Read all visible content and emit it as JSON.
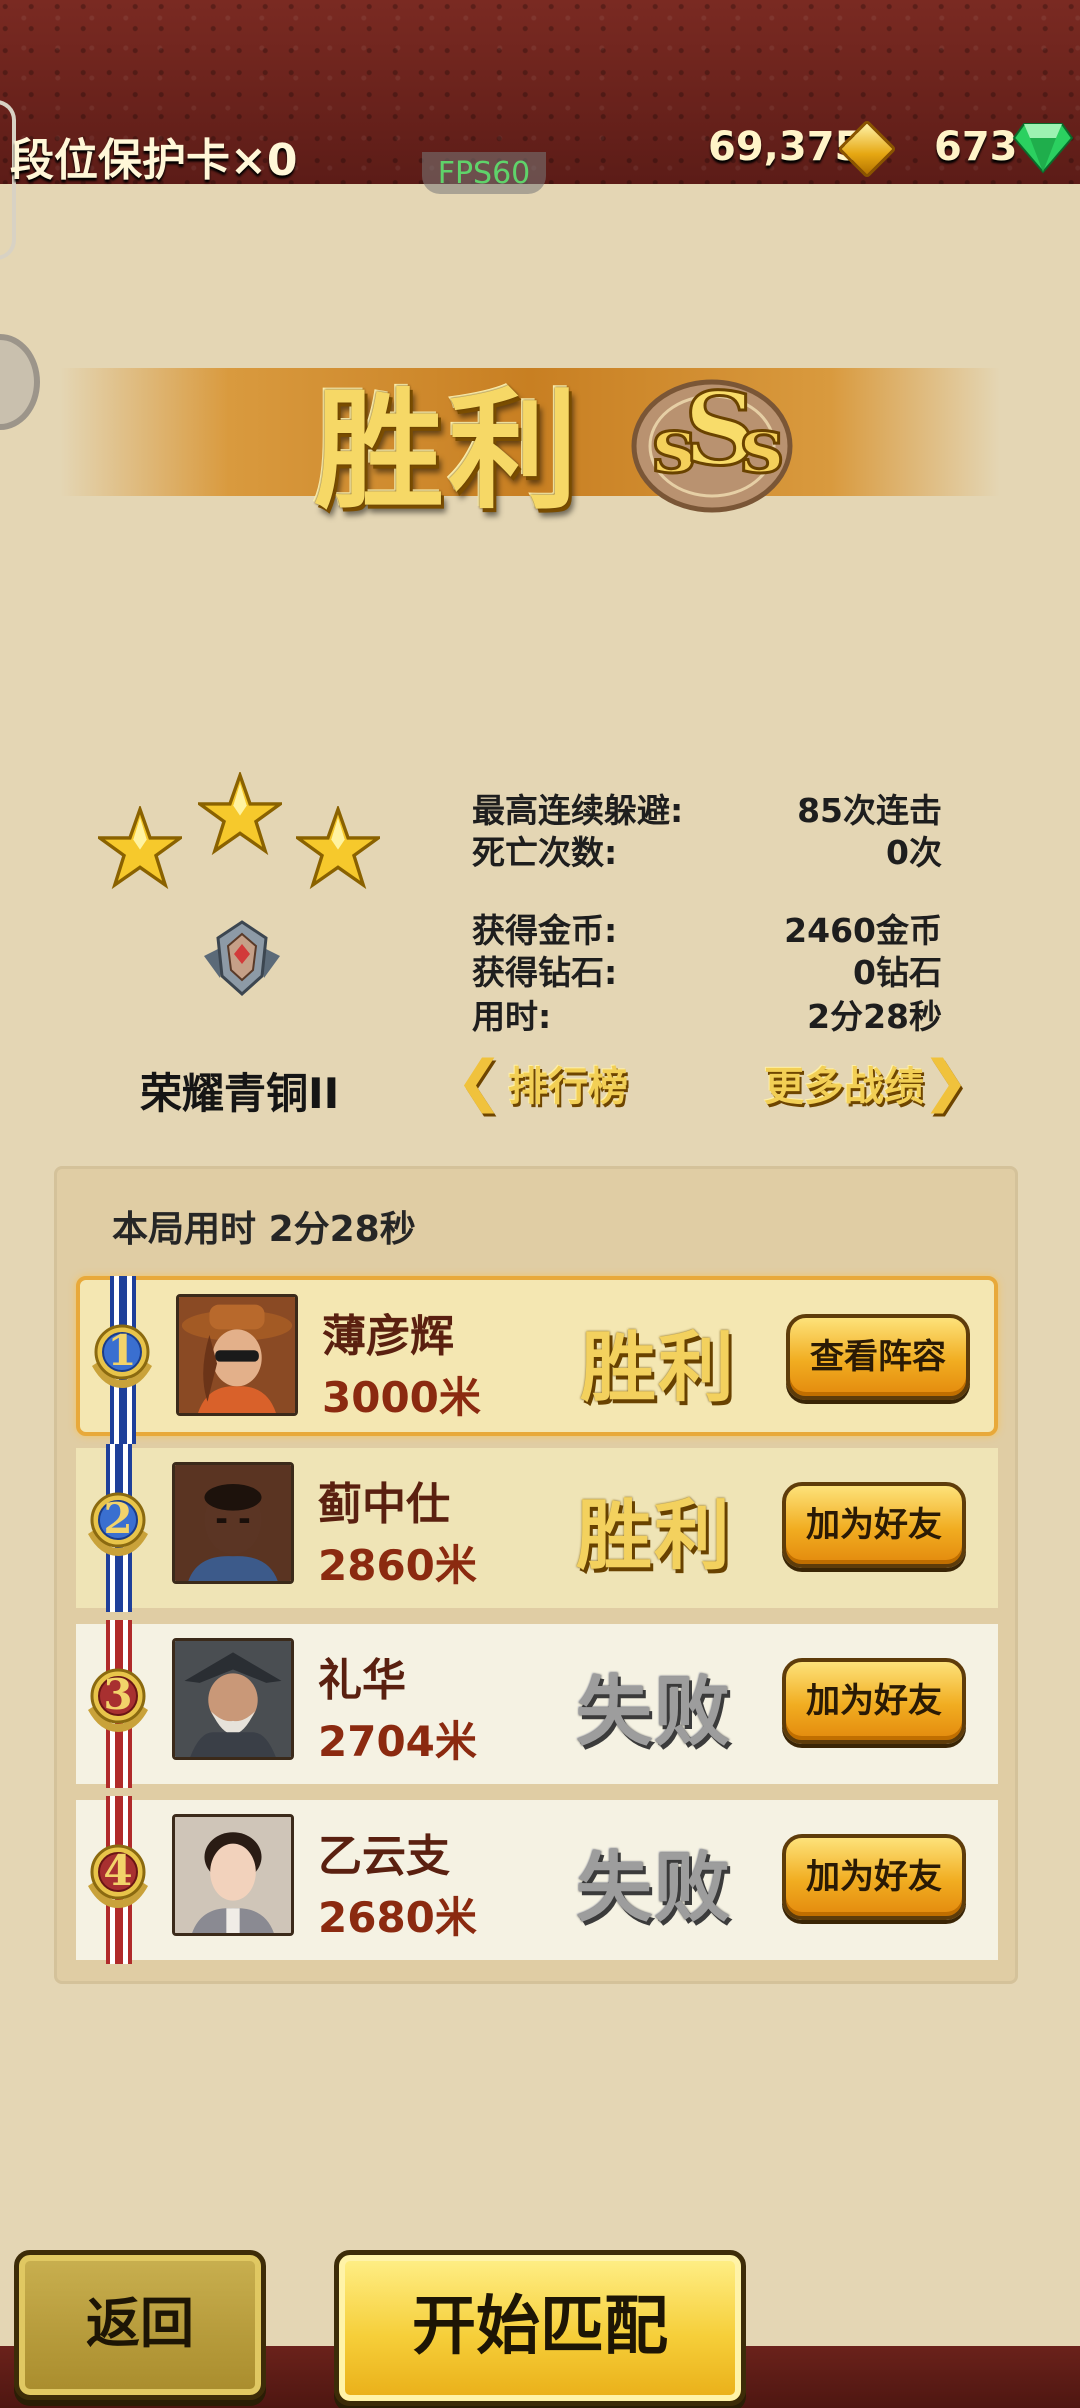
{
  "topbar": {
    "protect_card": "段位保护卡×0",
    "coins": "69,375",
    "gems": "673",
    "fps": "FPS60",
    "coin_icon": "diamond-coin-icon",
    "gem_icon": "green-gem-icon"
  },
  "banner": {
    "title": "胜利",
    "grade": "SSS"
  },
  "rank": {
    "stars": 3,
    "name": "荣耀青铜II"
  },
  "stats": {
    "combo_label": "最高连续躲避:",
    "combo_value": "85次连击",
    "deaths_label": "死亡次数:",
    "deaths_value": "0次",
    "gold_label": "获得金币:",
    "gold_value": "2460金币",
    "diamond_label": "获得钻石:",
    "diamond_value": "0钻石",
    "time_label": "用时:",
    "time_value": "2分28秒"
  },
  "links": {
    "leaderboard": "排行榜",
    "more_records": "更多战绩"
  },
  "results": {
    "time_label": "本局用时",
    "time_value": "2分28秒",
    "players": [
      {
        "rank": "1",
        "name": "薄彦辉",
        "distance": "3000米",
        "result": "胜利",
        "button": "查看阵容"
      },
      {
        "rank": "2",
        "name": "蓟中仕",
        "distance": "2860米",
        "result": "胜利",
        "button": "加为好友"
      },
      {
        "rank": "3",
        "name": "礼华",
        "distance": "2704米",
        "result": "失败",
        "button": "加为好友"
      },
      {
        "rank": "4",
        "name": "乙云支",
        "distance": "2680米",
        "result": "失败",
        "button": "加为好友"
      }
    ]
  },
  "bottom": {
    "back": "返回",
    "start": "开始匹配"
  },
  "colors": {
    "background": "#e4d6b4",
    "topbar": "#6b221b",
    "gold": "#f3d15e",
    "lose_gray": "#9d9d9d",
    "button_orange": "#f1ad21"
  }
}
